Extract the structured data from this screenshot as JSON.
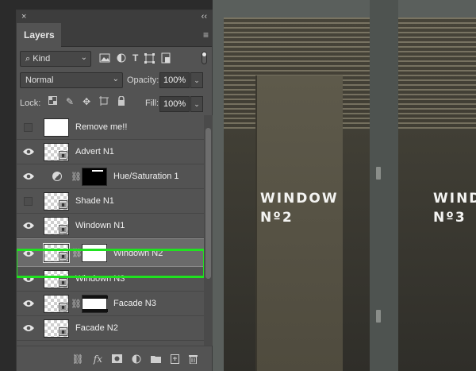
{
  "panel": {
    "close_glyph": "×",
    "collapse_glyph": "‹‹",
    "tab_label": "Layers",
    "menu_glyph": "≡"
  },
  "filter": {
    "kind_label": "Kind",
    "search_glyph": "⌕",
    "icons": [
      "image-filter-icon",
      "adjustment-filter-icon",
      "type-filter-icon",
      "shape-filter-icon",
      "smart-object-filter-icon"
    ]
  },
  "blend": {
    "mode": "Normal",
    "opacity_label": "Opacity:",
    "opacity_value": "100%"
  },
  "lock": {
    "label": "Lock:",
    "fill_label": "Fill:",
    "fill_value": "100%"
  },
  "layers": [
    {
      "name": "Remove me!!",
      "visible": false,
      "type": "normal",
      "selected": false
    },
    {
      "name": "Advert N1",
      "visible": true,
      "type": "smart",
      "selected": false
    },
    {
      "name": "Hue/Saturation 1",
      "visible": true,
      "type": "adjustment",
      "selected": false
    },
    {
      "name": "Shade N1",
      "visible": false,
      "type": "smart",
      "selected": false
    },
    {
      "name": "Windown N1",
      "visible": true,
      "type": "smart",
      "selected": false
    },
    {
      "name": "Windown N2",
      "visible": true,
      "type": "smart-mask",
      "selected": true
    },
    {
      "name": "Windown N3",
      "visible": true,
      "type": "smart",
      "selected": false
    },
    {
      "name": "Facade N3",
      "visible": true,
      "type": "smart-mask",
      "selected": false
    },
    {
      "name": "Facade N2",
      "visible": true,
      "type": "smart",
      "selected": false
    }
  ],
  "bottom_icons": [
    "link-layers-icon",
    "fx-icon",
    "add-mask-icon",
    "new-adjustment-icon",
    "new-group-icon",
    "new-layer-icon",
    "trash-icon"
  ],
  "bottom": {
    "fx_label": "fx"
  },
  "photo": {
    "sign1_line1": "WINDOW",
    "sign1_line2": "Nº2",
    "sign2_line1": "WIND",
    "sign2_line2": "Nº3"
  },
  "colors": {
    "highlight": "#1fe21f",
    "panel_bg": "#535353",
    "selected_row": "#6b6b6b"
  }
}
